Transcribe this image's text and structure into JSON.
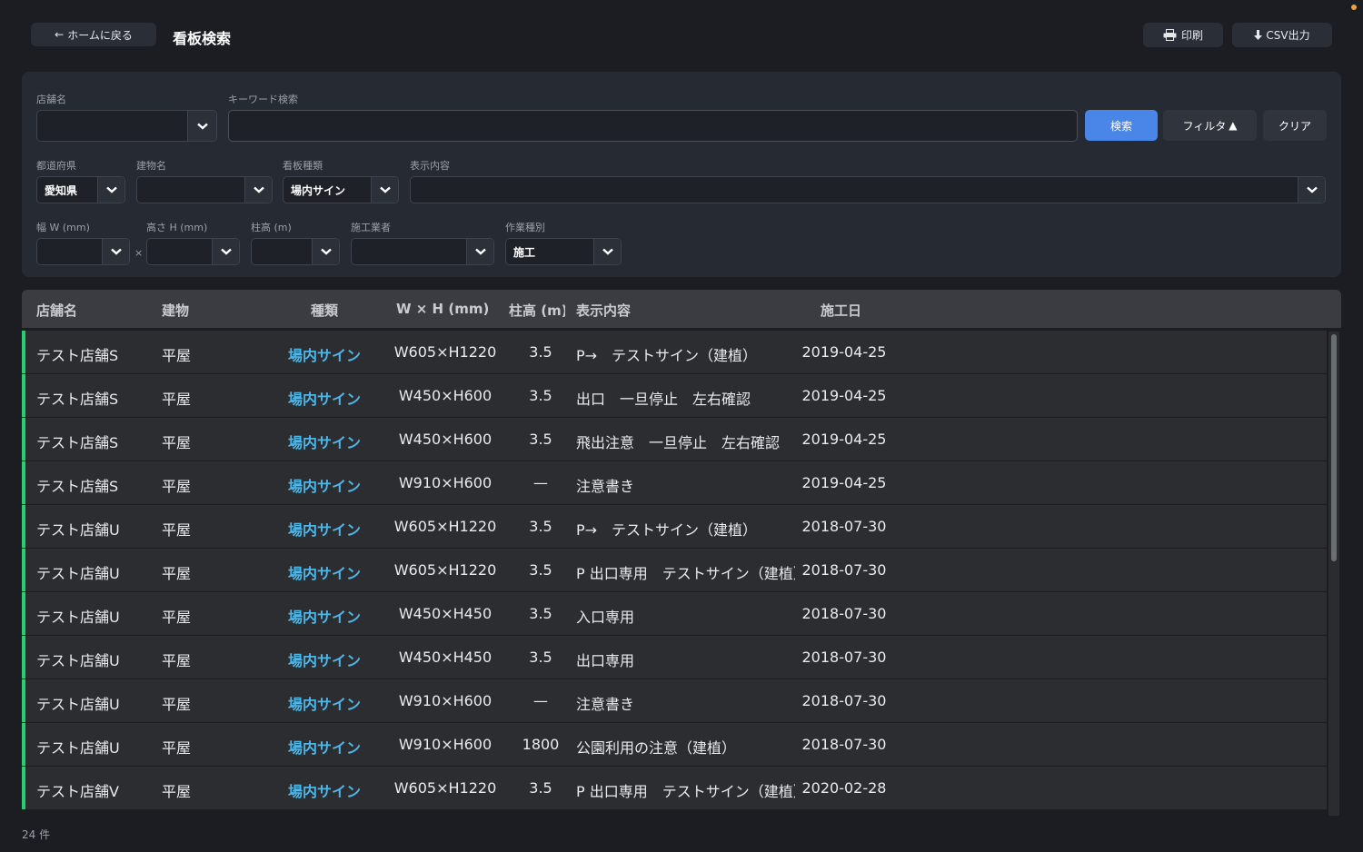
{
  "header": {
    "back_label": "ホームに戻る",
    "title": "看板検索",
    "print_label": "印刷",
    "csv_label": "CSV出力"
  },
  "filters": {
    "shop_label": "店舗名",
    "shop_value": "",
    "keyword_label": "キーワード検索",
    "keyword_value": "",
    "search_label": "検索",
    "filter_label": "フィルタ",
    "clear_label": "クリア",
    "pref_label": "都道府県",
    "pref_value": "愛知県",
    "building_label": "建物名",
    "building_value": "",
    "signtype_label": "看板種類",
    "signtype_value": "場内サイン",
    "display_label": "表示内容",
    "display_value": "",
    "width_label": "幅 W (mm)",
    "width_value": "",
    "times": "×",
    "height_label": "高さ H (mm)",
    "height_value": "",
    "pole_label": "柱高 (m)",
    "pole_value": "",
    "contractor_label": "施工業者",
    "contractor_value": "",
    "worktype_label": "作業種別",
    "worktype_value": "施工"
  },
  "table": {
    "columns": [
      "店舗名",
      "建物",
      "種類",
      "W × H (mm)",
      "柱高 (m)",
      "表示内容",
      "施工日"
    ],
    "rows": [
      {
        "shop": "テスト店舗S",
        "building": "平屋",
        "type": "場内サイン",
        "size": "W605×H1220",
        "pole": "3.5",
        "display": "P→　テストサイン（建植）",
        "date": "2019-04-25"
      },
      {
        "shop": "テスト店舗S",
        "building": "平屋",
        "type": "場内サイン",
        "size": "W450×H600",
        "pole": "3.5",
        "display": "出口　一旦停止　左右確認",
        "date": "2019-04-25"
      },
      {
        "shop": "テスト店舗S",
        "building": "平屋",
        "type": "場内サイン",
        "size": "W450×H600",
        "pole": "3.5",
        "display": "飛出注意　一旦停止　左右確認",
        "date": "2019-04-25"
      },
      {
        "shop": "テスト店舗S",
        "building": "平屋",
        "type": "場内サイン",
        "size": "W910×H600",
        "pole": "—",
        "display": "注意書き",
        "date": "2019-04-25"
      },
      {
        "shop": "テスト店舗U",
        "building": "平屋",
        "type": "場内サイン",
        "size": "W605×H1220",
        "pole": "3.5",
        "display": "P→　テストサイン（建植）",
        "date": "2018-07-30"
      },
      {
        "shop": "テスト店舗U",
        "building": "平屋",
        "type": "場内サイン",
        "size": "W605×H1220",
        "pole": "3.5",
        "display": "P 出口専用　テストサイン（建植）",
        "date": "2018-07-30"
      },
      {
        "shop": "テスト店舗U",
        "building": "平屋",
        "type": "場内サイン",
        "size": "W450×H450",
        "pole": "3.5",
        "display": "入口専用",
        "date": "2018-07-30"
      },
      {
        "shop": "テスト店舗U",
        "building": "平屋",
        "type": "場内サイン",
        "size": "W450×H450",
        "pole": "3.5",
        "display": "出口専用",
        "date": "2018-07-30"
      },
      {
        "shop": "テスト店舗U",
        "building": "平屋",
        "type": "場内サイン",
        "size": "W910×H600",
        "pole": "—",
        "display": "注意書き",
        "date": "2018-07-30"
      },
      {
        "shop": "テスト店舗U",
        "building": "平屋",
        "type": "場内サイン",
        "size": "W910×H600",
        "pole": "1800",
        "display": "公園利用の注意（建植）",
        "date": "2018-07-30"
      },
      {
        "shop": "テスト店舗V",
        "building": "平屋",
        "type": "場内サイン",
        "size": "W605×H1220",
        "pole": "3.5",
        "display": "P 出口専用　テストサイン（建植）",
        "date": "2020-02-28"
      }
    ]
  },
  "footer": {
    "count": "24 件"
  },
  "colors": {
    "accent": "#4a86e8",
    "row_marker": "#2ecc71",
    "type_text": "#4fb6e8",
    "notification_dot": "#e8a33a"
  }
}
